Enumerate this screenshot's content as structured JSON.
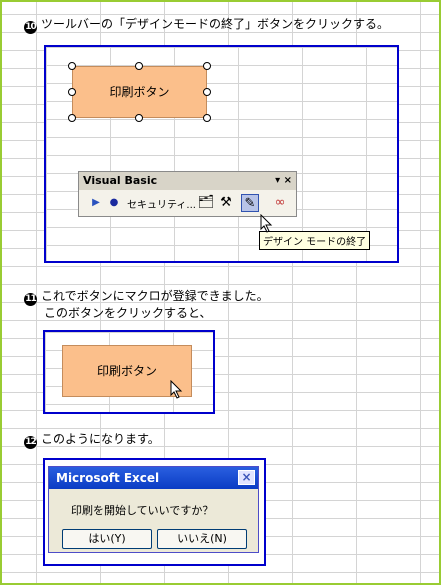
{
  "steps": [
    {
      "num": "10",
      "text": "ツールバーの「デザインモードの終了」ボタンをクリックする。"
    },
    {
      "num": "11",
      "line1": "これでボタンにマクロが登録できました。",
      "line2": "このボタンをクリックすると、"
    },
    {
      "num": "12",
      "text": "このようになります。"
    }
  ],
  "button_label": "印刷ボタン",
  "toolbar": {
    "title": "Visual Basic",
    "controls": "▾ ×",
    "security_label": "セキュリティ...",
    "tooltip": "デザイン モードの終了"
  },
  "dialog": {
    "title": "Microsoft Excel",
    "close": "×",
    "message": "印刷を開始していいですか？",
    "yes": "はい(Y)",
    "no": "いいえ(N)"
  },
  "colors": {
    "accent_border": "#0000cc",
    "button_fill": "#fbbf8b",
    "frame": "#99cc33"
  }
}
